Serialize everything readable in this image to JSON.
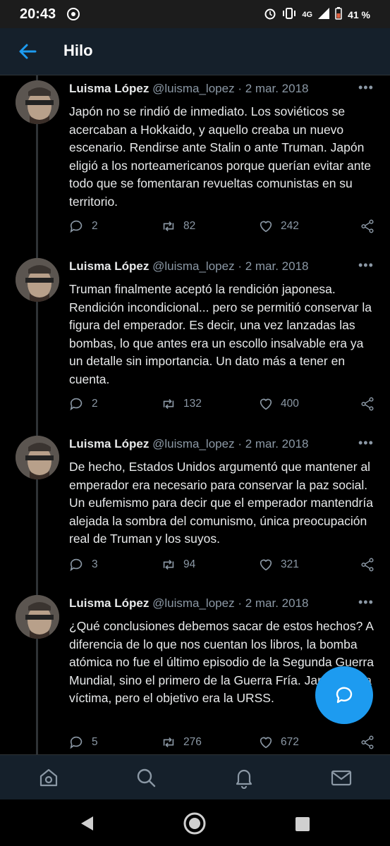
{
  "status_bar": {
    "time": "20:43",
    "network": "4G",
    "battery": "41 %"
  },
  "header": {
    "title": "Hilo"
  },
  "tweets": [
    {
      "name": "Luisma López",
      "handle": "@luisma_lopez",
      "date": "· 2 mar. 2018",
      "text": "Japón no se rindió de inmediato. Los soviéticos se acercaban a Hokkaido, y aquello creaba un nuevo escenario. Rendirse ante Stalin o ante Truman. Japón eligió a los norteamericanos porque querían evitar ante todo que se fomentaran revueltas comunistas en su territorio.",
      "replies": "2",
      "retweets": "82",
      "likes": "242"
    },
    {
      "name": "Luisma López",
      "handle": "@luisma_lopez",
      "date": "· 2 mar. 2018",
      "text": "Truman finalmente aceptó la rendición japonesa. Rendición incondicional... pero se permitió conservar la figura del emperador. Es decir, una vez lanzadas las bombas, lo que antes era un escollo insalvable era ya un detalle sin importancia. Un dato más a tener en cuenta.",
      "replies": "2",
      "retweets": "132",
      "likes": "400"
    },
    {
      "name": "Luisma López",
      "handle": "@luisma_lopez",
      "date": "· 2 mar. 2018",
      "text": "De hecho, Estados Unidos argumentó que mantener al emperador era necesario para conservar la paz social. Un eufemismo para decir que el emperador mantendría alejada la sombra del comunismo, única preocupación real de Truman y los suyos.",
      "replies": "3",
      "retweets": "94",
      "likes": "321"
    },
    {
      "name": "Luisma López",
      "handle": "@luisma_lopez",
      "date": "· 2 mar. 2018",
      "text": "¿Qué conclusiones debemos sacar de estos hechos? A diferencia de lo que nos cuentan los libros, la bomba atómica no fue el último episodio de la Segunda Guerra Mundial, sino el primero de la Guerra Fría. Japón fue la víctima, pero el objetivo era la URSS.",
      "replies": "5",
      "retweets": "276",
      "likes": "672"
    }
  ],
  "colors": {
    "accent": "#1d9bf0",
    "background": "#000000",
    "header": "#15202b",
    "muted": "#8b98a5"
  }
}
